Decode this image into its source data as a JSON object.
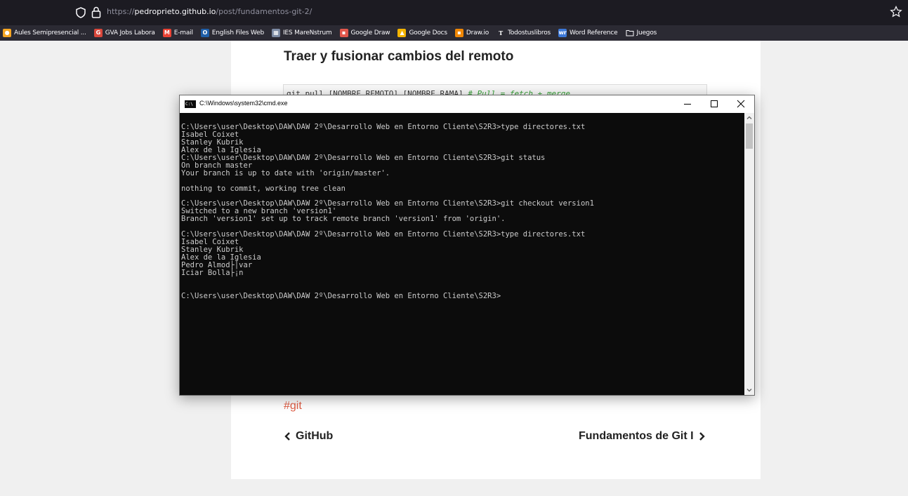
{
  "browser": {
    "url_prefix": "https://",
    "url_host": "pedroprieto.github.io",
    "url_path": "/post/fundamentos-git-2/",
    "bookmarks": [
      {
        "label": "Aules Semipresencial ...",
        "icon": "aules-icon",
        "color": "#f6a623",
        "glyph": "●"
      },
      {
        "label": "GVA Jobs Labora",
        "icon": "gva-icon",
        "color": "#d9473b",
        "glyph": "G"
      },
      {
        "label": "E-mail",
        "icon": "gmail-icon",
        "color": "#ea4335",
        "glyph": "M"
      },
      {
        "label": "English Files Web",
        "icon": "oxford-icon",
        "color": "#1f5fa8",
        "glyph": "O"
      },
      {
        "label": "IES MareNstrum",
        "icon": "ies-icon",
        "color": "#7c8aa3",
        "glyph": "▦"
      },
      {
        "label": "Google Draw",
        "icon": "google-draw-icon",
        "color": "#e2574c",
        "glyph": "▪"
      },
      {
        "label": "Google Docs",
        "icon": "google-docs-icon",
        "color": "#f4b400",
        "glyph": "▲"
      },
      {
        "label": "Draw.io",
        "icon": "drawio-icon",
        "color": "#f08705",
        "glyph": "▪"
      },
      {
        "label": "Todostuslibros",
        "icon": "todostuslibros-icon",
        "color": "#2b2a33",
        "glyph": "T"
      },
      {
        "label": "Word Reference",
        "icon": "wordreference-icon",
        "color": "#3c78d8",
        "glyph": "wr"
      },
      {
        "label": "Juegos",
        "icon": "folder-icon",
        "color": "#2b2a33",
        "glyph": ""
      }
    ]
  },
  "article": {
    "heading": "Traer y fusionar cambios del remoto",
    "code_text": "git pull [NOMBRE_REMOTO] [NOMBRE_RAMA] ",
    "code_comment": "# Pull = fetch + merge",
    "tag": "#git",
    "prev_label": "GitHub",
    "next_label": "Fundamentos de Git I"
  },
  "cmd": {
    "title": "C:\\Windows\\system32\\cmd.exe",
    "icon_text": "C:\\",
    "lines": [
      "C:\\Users\\user\\Desktop\\DAW\\DAW 2º\\Desarrollo Web en Entorno Cliente\\S2R3>type directores.txt",
      "Isabel Coixet",
      "Stanley Kubrik",
      "Alex de la Iglesia",
      "C:\\Users\\user\\Desktop\\DAW\\DAW 2º\\Desarrollo Web en Entorno Cliente\\S2R3>git status",
      "On branch master",
      "Your branch is up to date with 'origin/master'.",
      "",
      "nothing to commit, working tree clean",
      "",
      "C:\\Users\\user\\Desktop\\DAW\\DAW 2º\\Desarrollo Web en Entorno Cliente\\S2R3>git checkout version1",
      "Switched to a new branch 'version1'",
      "Branch 'version1' set up to track remote branch 'version1' from 'origin'.",
      "",
      "C:\\Users\\user\\Desktop\\DAW\\DAW 2º\\Desarrollo Web en Entorno Cliente\\S2R3>type directores.txt",
      "Isabel Coixet",
      "Stanley Kubrik",
      "Alex de la Iglesia",
      "Pedro Almod├│var",
      "Iciar Bolla├¡n",
      "",
      "",
      "C:\\Users\\user\\Desktop\\DAW\\DAW 2º\\Desarrollo Web en Entorno Cliente\\S2R3>"
    ]
  }
}
